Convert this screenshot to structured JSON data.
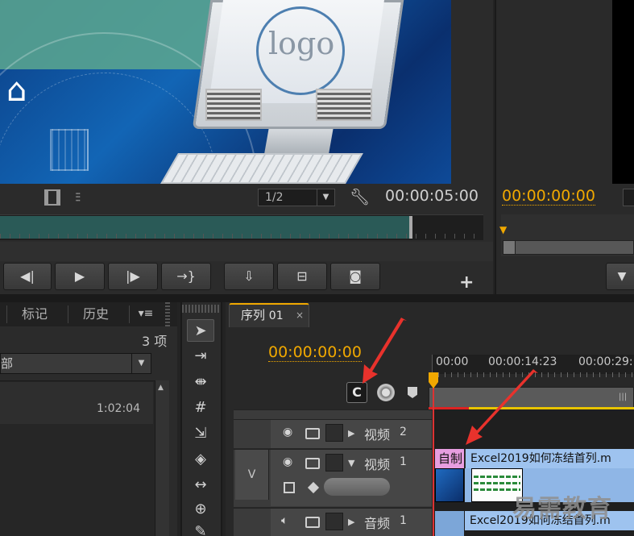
{
  "source_monitor": {
    "zoom_value": "1/2",
    "duration_timecode": "00:00:05:00",
    "preview_logo_text": "logo",
    "scrub_progress": 0.85
  },
  "program_monitor": {
    "timecode": "00:00:00:00"
  },
  "buttons": {
    "step_back": "◀|",
    "play": "▶",
    "step_forward": "|▶",
    "go_to_out": "→}",
    "insert": "⇩",
    "overwrite": "⊟",
    "export_frame": "◙",
    "add": "+"
  },
  "left_panel": {
    "tabs": [
      "标记",
      "历史"
    ],
    "menu_glyph": "▾≡",
    "item_count": "3 项",
    "filter_value": "部",
    "list_item_duration": "1:02:04"
  },
  "timeline": {
    "sequence_tab": "序列",
    "sequence_num": "01",
    "close_glyph": "×",
    "timecode": "00:00:00:00",
    "ruler_labels": [
      "00:00",
      "00:00:14:23",
      "00:00:29:"
    ],
    "snap_glyph": "C",
    "tracks": [
      {
        "name": "视频",
        "num": "2"
      },
      {
        "name": "视频",
        "num": "1",
        "target": "V"
      },
      {
        "name": "音频",
        "num": "1"
      }
    ],
    "clips": {
      "title_clip": "自制",
      "video_clip": "Excel2019如何冻结首列.m",
      "audio_clip": "Excel2019如何冻结首列.m"
    }
  },
  "watermark": "易需教育",
  "colors": {
    "accent_timecode": "#f0a800",
    "annotation_arrow": "#e8322c",
    "video_clip": "#9ec3ef",
    "title_clip": "#e79ee0"
  },
  "icons": [
    "film-icon",
    "audio-wave-icon",
    "wrench-icon",
    "selection-tool-icon",
    "track-select-icon",
    "ripple-edit-icon",
    "rolling-edit-icon",
    "rate-stretch-icon",
    "razor-icon",
    "slip-icon",
    "slide-icon",
    "pen-icon",
    "eye-icon",
    "speaker-icon",
    "snap-icon",
    "marker-icon"
  ]
}
